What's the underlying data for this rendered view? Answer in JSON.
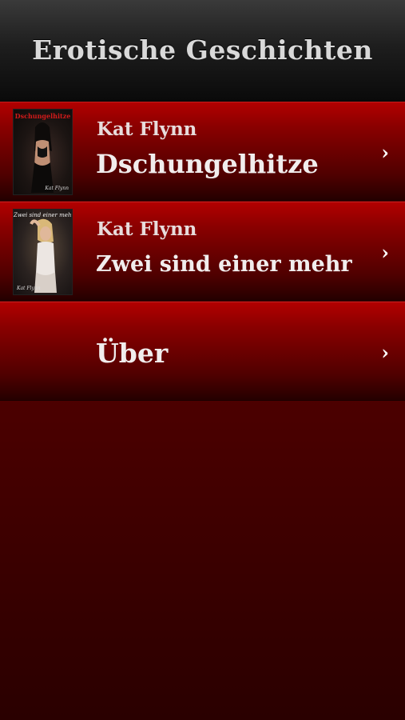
{
  "navbar": {
    "title": "Erotische Geschichten"
  },
  "list": [
    {
      "author": "Kat Flynn",
      "title": "Dschungelhitze",
      "cover_title": "Dschungelhitze",
      "cover_author": "Kat Flynn",
      "chevron": "›"
    },
    {
      "author": "Kat Flynn",
      "title": "Zwei sind einer mehr",
      "cover_title": "Zwei sind einer mehr",
      "cover_author": "Kat Flynn",
      "chevron": "›"
    },
    {
      "title": "Über",
      "chevron": "›"
    }
  ],
  "colors": {
    "navbar_bg": "#1e1e1e",
    "row_highlight": "#b20000",
    "row_base": "#4e0000",
    "background": "#500000",
    "cover_title_red": "#d21a1a"
  }
}
